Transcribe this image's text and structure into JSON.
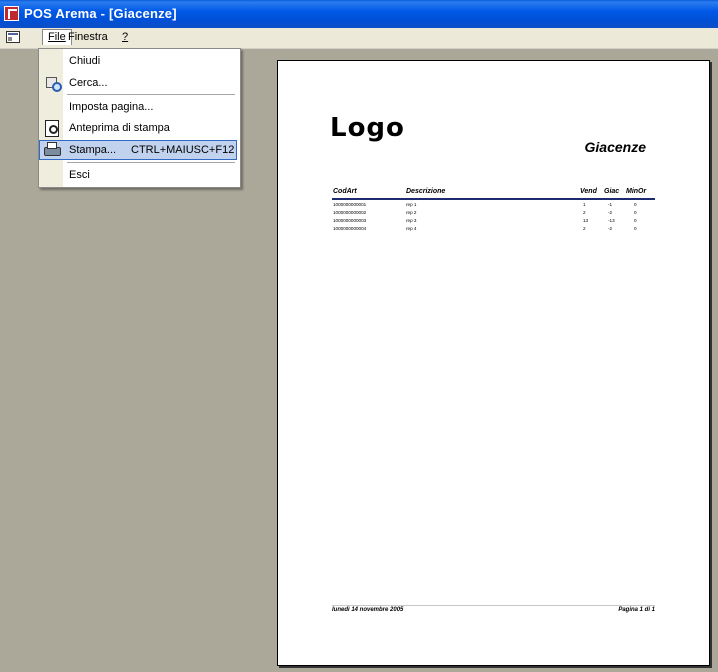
{
  "window": {
    "title": "POS Arema - [Giacenze]"
  },
  "menubar": {
    "items": [
      {
        "label": "File"
      },
      {
        "label": "Finestra"
      },
      {
        "label": "?"
      }
    ]
  },
  "file_menu": {
    "items": [
      {
        "label": "Chiudi",
        "icon": ""
      },
      {
        "label": "Cerca...",
        "icon": "find-icon"
      },
      {
        "label": "Imposta pagina...",
        "icon": ""
      },
      {
        "label": "Anteprima di stampa",
        "icon": "print-preview-icon"
      },
      {
        "label": "Stampa...",
        "shortcut": "CTRL+MAIUSC+F12",
        "icon": "printer-icon",
        "highlighted": true
      },
      {
        "label": "Esci",
        "icon": ""
      }
    ]
  },
  "report": {
    "logo": "Logo",
    "title": "Giacenze",
    "columns": [
      "CodArt",
      "Descrizione",
      "Vend",
      "Giac",
      "MinOr"
    ],
    "rows": [
      {
        "code": "1000000000001",
        "desc": "rep 1",
        "vend": "1",
        "giac": "-1",
        "minor": "0"
      },
      {
        "code": "1000000000002",
        "desc": "rep 2",
        "vend": "2",
        "giac": "-2",
        "minor": "0"
      },
      {
        "code": "1000000000003",
        "desc": "rep 3",
        "vend": "13",
        "giac": "-13",
        "minor": "0"
      },
      {
        "code": "1000000000004",
        "desc": "rep 4",
        "vend": "2",
        "giac": "-2",
        "minor": "0"
      }
    ],
    "footer_date": "lunedì 14 novembre 2005",
    "footer_page": "Pagina 1 di 1"
  },
  "colors": {
    "titlebar": "#0058e6",
    "menu_highlight": "#c1d2ee",
    "workspace": "#aca899",
    "header_rule": "#1d2a6e"
  }
}
